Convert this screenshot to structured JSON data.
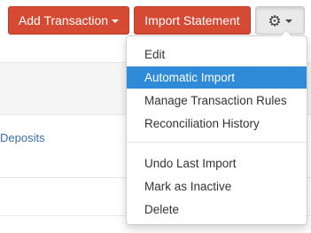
{
  "toolbar": {
    "add_transaction_label": "Add Transaction",
    "import_statement_label": "Import Statement",
    "gear_icon": "gear-icon"
  },
  "page": {
    "deposits_link": "Deposits"
  },
  "menu": {
    "items": [
      {
        "label": "Edit"
      },
      {
        "label": "Automatic Import"
      },
      {
        "label": "Manage Transaction Rules"
      },
      {
        "label": "Reconciliation History"
      },
      {
        "label": "Undo Last Import"
      },
      {
        "label": "Mark as Inactive"
      },
      {
        "label": "Delete"
      }
    ],
    "active_item": "Automatic Import"
  },
  "colors": {
    "primary_button": "#d54a33",
    "menu_highlight": "#2f8ad8",
    "link": "#3a6ea5"
  }
}
